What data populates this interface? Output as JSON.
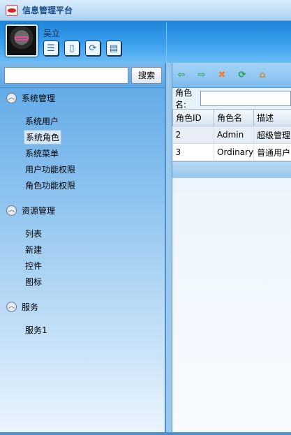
{
  "app": {
    "title": "信息管理平台",
    "logo_icon": "app-logo-icon"
  },
  "header": {
    "username": "吴立",
    "icons": [
      "list-icon",
      "document-icon",
      "refresh-document-icon",
      "notes-icon"
    ]
  },
  "search": {
    "value": "",
    "button_label": "搜索"
  },
  "menu": {
    "groups": [
      {
        "title": "系统管理",
        "items": [
          "系统用户",
          "系统角色",
          "系统菜单",
          "用户功能权限",
          "角色功能权限"
        ],
        "selected": "系统角色"
      },
      {
        "title": "资源管理",
        "items": [
          "列表",
          "新建",
          "控件",
          "图标"
        ]
      },
      {
        "title": "服务",
        "items": [
          "服务1"
        ]
      }
    ]
  },
  "toolbar": {
    "buttons": [
      "back-icon",
      "forward-icon",
      "delete-icon",
      "refresh-icon",
      "home-icon"
    ]
  },
  "filter": {
    "label": "角色名:",
    "value": ""
  },
  "table": {
    "columns": [
      "角色ID",
      "角色名",
      "描述"
    ],
    "rows": [
      [
        "2",
        "Admin",
        "超级管理"
      ],
      [
        "3",
        "Ordinary",
        "普通用户"
      ]
    ]
  },
  "colors": {
    "header_blue": "#1f85d9",
    "panel_blue": "#5aa6e6",
    "title_text": "#1c4f8a"
  }
}
